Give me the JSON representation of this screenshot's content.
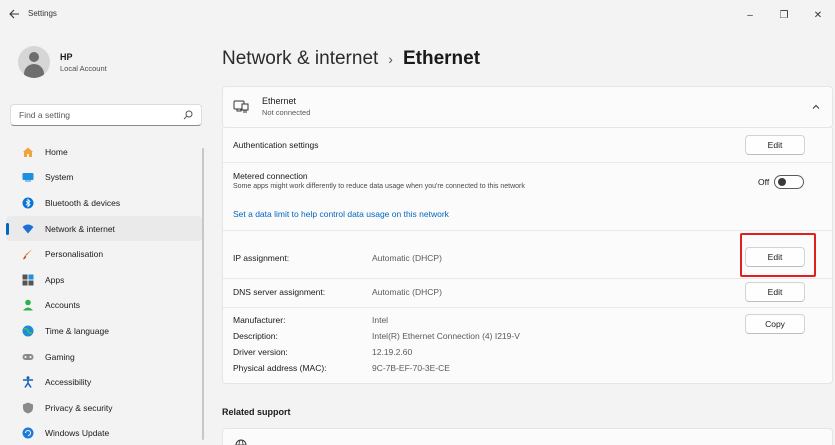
{
  "window": {
    "title": "Settings",
    "controls": {
      "minimize": "–",
      "maximize": "❐",
      "close": "✕"
    }
  },
  "profile": {
    "name": "HP",
    "account_type": "Local Account"
  },
  "search": {
    "placeholder": "Find a setting",
    "value": ""
  },
  "sidebar": {
    "items": [
      {
        "label": "Home",
        "icon": "home-icon",
        "active": false
      },
      {
        "label": "System",
        "icon": "system-icon",
        "active": false
      },
      {
        "label": "Bluetooth & devices",
        "icon": "bluetooth-icon",
        "active": false
      },
      {
        "label": "Network & internet",
        "icon": "wifi-icon",
        "active": true
      },
      {
        "label": "Personalisation",
        "icon": "brush-icon",
        "active": false
      },
      {
        "label": "Apps",
        "icon": "apps-icon",
        "active": false
      },
      {
        "label": "Accounts",
        "icon": "accounts-icon",
        "active": false
      },
      {
        "label": "Time & language",
        "icon": "globe-clock-icon",
        "active": false
      },
      {
        "label": "Gaming",
        "icon": "gamepad-icon",
        "active": false
      },
      {
        "label": "Accessibility",
        "icon": "accessibility-icon",
        "active": false
      },
      {
        "label": "Privacy & security",
        "icon": "shield-icon",
        "active": false
      },
      {
        "label": "Windows Update",
        "icon": "update-icon",
        "active": false
      }
    ]
  },
  "breadcrumb": {
    "parent": "Network & internet",
    "separator": "›",
    "current": "Ethernet"
  },
  "ethernet": {
    "title": "Ethernet",
    "status": "Not connected",
    "authentication": {
      "label": "Authentication settings",
      "button": "Edit"
    },
    "metered": {
      "label": "Metered connection",
      "description": "Some apps might work differently to reduce data usage when you're connected to this network",
      "state": "Off",
      "on": false,
      "link": "Set a data limit to help control data usage on this network"
    },
    "ip": {
      "label": "IP assignment:",
      "value": "Automatic (DHCP)",
      "button": "Edit"
    },
    "dns": {
      "label": "DNS server assignment:",
      "value": "Automatic (DHCP)",
      "button": "Edit"
    },
    "properties": {
      "button": "Copy",
      "rows": [
        {
          "label": "Manufacturer:",
          "value": "Intel"
        },
        {
          "label": "Description:",
          "value": "Intel(R) Ethernet Connection (4) I219-V"
        },
        {
          "label": "Driver version:",
          "value": "12.19.2.60"
        },
        {
          "label": "Physical address (MAC):",
          "value": "9C-7B-EF-70-3E-CE"
        }
      ]
    }
  },
  "related_support": {
    "title": "Related support"
  },
  "colors": {
    "accent": "#0067c0",
    "highlight": "#e02020",
    "background": "#f3f3f3"
  }
}
